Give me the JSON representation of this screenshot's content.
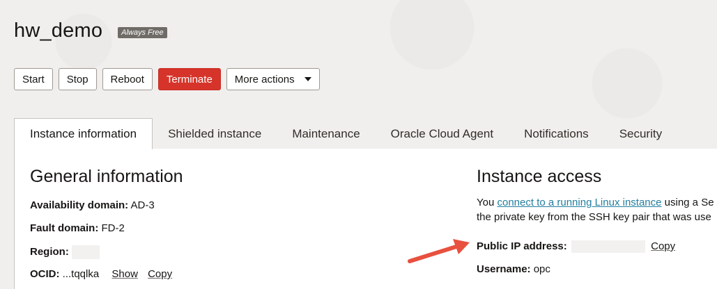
{
  "header": {
    "title": "hw_demo",
    "badge": "Always Free"
  },
  "actions": {
    "start": "Start",
    "stop": "Stop",
    "reboot": "Reboot",
    "terminate": "Terminate",
    "more": "More actions"
  },
  "tabs": [
    {
      "label": "Instance information"
    },
    {
      "label": "Shielded instance"
    },
    {
      "label": "Maintenance"
    },
    {
      "label": "Oracle Cloud Agent"
    },
    {
      "label": "Notifications"
    },
    {
      "label": "Security"
    }
  ],
  "general": {
    "title": "General information",
    "availability_label": "Availability domain:",
    "availability_value": "AD-3",
    "fault_label": "Fault domain:",
    "fault_value": "FD-2",
    "region_label": "Region:",
    "ocid_label": "OCID:",
    "ocid_value": "...tqqlka",
    "show": "Show",
    "copy": "Copy"
  },
  "access": {
    "title": "Instance access",
    "line1_prefix": "You",
    "line1_link": "connect to a running Linux instance",
    "line1_suffix": "using a Se",
    "line2": "the private key from the SSH key pair that was use",
    "public_ip_label": "Public IP address:",
    "copy": "Copy",
    "username_label": "Username:",
    "username_value": "opc"
  },
  "colors": {
    "danger": "#d6342a",
    "link": "#227e9e",
    "arrow": "#e8503f"
  }
}
